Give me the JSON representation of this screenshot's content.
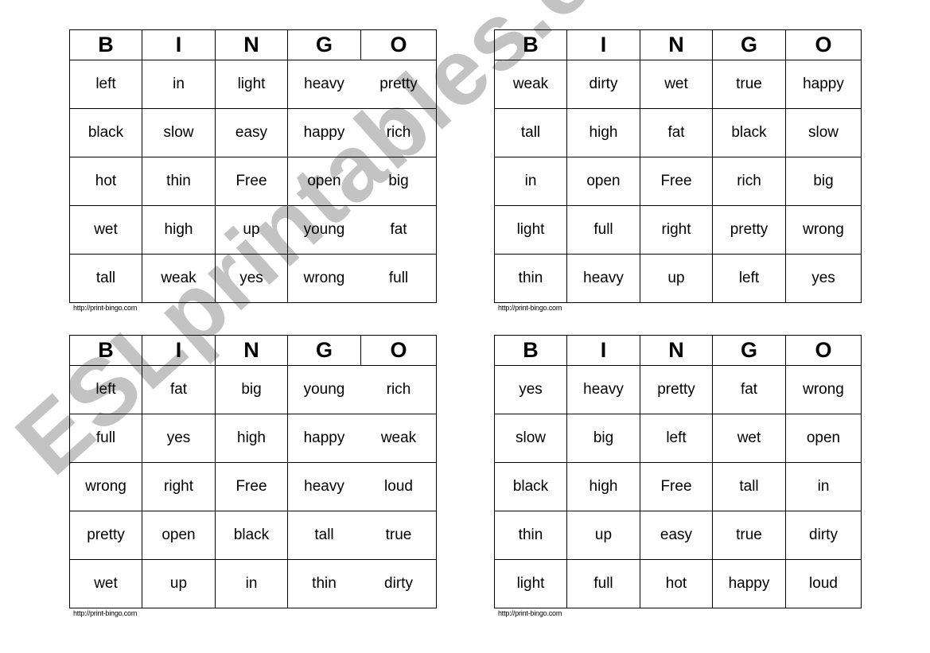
{
  "header_letters": [
    "B",
    "I",
    "N",
    "G",
    "O"
  ],
  "credit_text": "http://print-bingo.com",
  "watermark_text": "ESLprintables.com",
  "colors": {
    "grid": "#000000",
    "watermark": "#aaaaaa",
    "background": "#ffffff"
  },
  "cards": [
    {
      "rows": [
        [
          "left",
          "in",
          "light",
          "heavy",
          "pretty"
        ],
        [
          "black",
          "slow",
          "easy",
          "happy",
          "rich"
        ],
        [
          "hot",
          "thin",
          "Free",
          "open",
          "big"
        ],
        [
          "wet",
          "high",
          "up",
          "young",
          "fat"
        ],
        [
          "tall",
          "weak",
          "yes",
          "wrong",
          "full"
        ]
      ]
    },
    {
      "rows": [
        [
          "weak",
          "dirty",
          "wet",
          "true",
          "happy"
        ],
        [
          "tall",
          "high",
          "fat",
          "black",
          "slow"
        ],
        [
          "in",
          "open",
          "Free",
          "rich",
          "big"
        ],
        [
          "light",
          "full",
          "right",
          "pretty",
          "wrong"
        ],
        [
          "thin",
          "heavy",
          "up",
          "left",
          "yes"
        ]
      ]
    },
    {
      "rows": [
        [
          "left",
          "fat",
          "big",
          "young",
          "rich"
        ],
        [
          "full",
          "yes",
          "high",
          "happy",
          "weak"
        ],
        [
          "wrong",
          "right",
          "Free",
          "heavy",
          "loud"
        ],
        [
          "pretty",
          "open",
          "black",
          "tall",
          "true"
        ],
        [
          "wet",
          "up",
          "in",
          "thin",
          "dirty"
        ]
      ]
    },
    {
      "rows": [
        [
          "yes",
          "heavy",
          "pretty",
          "fat",
          "wrong"
        ],
        [
          "slow",
          "big",
          "left",
          "wet",
          "open"
        ],
        [
          "black",
          "high",
          "Free",
          "tall",
          "in"
        ],
        [
          "thin",
          "up",
          "easy",
          "true",
          "dirty"
        ],
        [
          "light",
          "full",
          "hot",
          "happy",
          "loud"
        ]
      ]
    }
  ]
}
